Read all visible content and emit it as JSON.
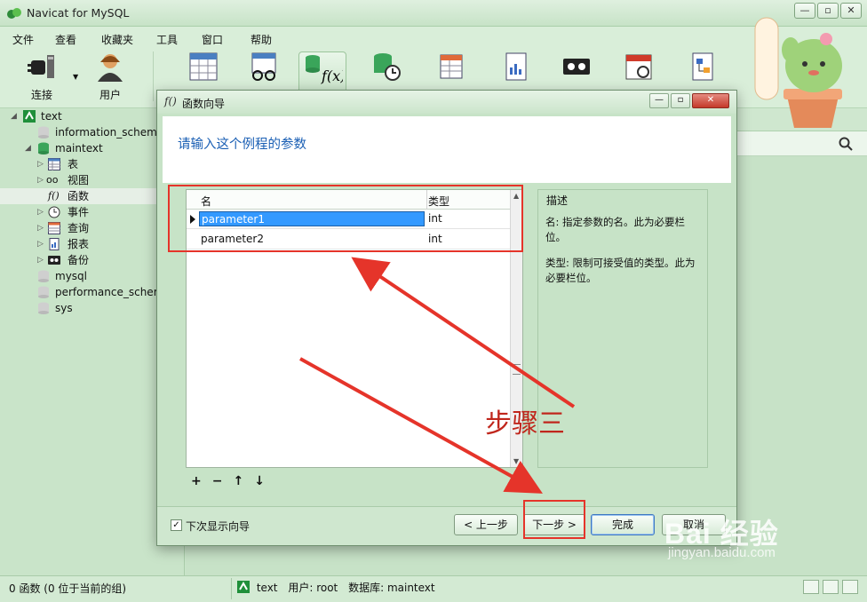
{
  "app": {
    "title": "Navicat for MySQL",
    "window_buttons": [
      "—",
      "▫",
      "✕"
    ]
  },
  "menu": [
    "文件",
    "查看",
    "收藏夹",
    "工具",
    "窗口",
    "帮助"
  ],
  "toolbar": {
    "connect_label": "连接",
    "user_label": "用户"
  },
  "sidebar": {
    "items": [
      {
        "label": "text",
        "icon": "connection-icon"
      },
      {
        "label": "information_schema",
        "icon": "database-icon"
      },
      {
        "label": "maintext",
        "icon": "database-icon"
      },
      {
        "label": "表",
        "icon": "table-icon"
      },
      {
        "label": "视图",
        "icon": "view-icon"
      },
      {
        "label": "函数",
        "icon": "function-icon"
      },
      {
        "label": "事件",
        "icon": "event-icon"
      },
      {
        "label": "查询",
        "icon": "query-icon"
      },
      {
        "label": "报表",
        "icon": "report-icon"
      },
      {
        "label": "备份",
        "icon": "backup-icon"
      },
      {
        "label": "mysql",
        "icon": "database-icon"
      },
      {
        "label": "performance_schema",
        "icon": "database-icon"
      },
      {
        "label": "sys",
        "icon": "database-icon"
      }
    ]
  },
  "dialog": {
    "icon_text": "f()",
    "title": "函数向导",
    "heading": "请输入这个例程的参数",
    "columns": {
      "name": "名",
      "type": "类型"
    },
    "rows": [
      {
        "name": "parameter1",
        "type": "int"
      },
      {
        "name": "parameter2",
        "type": "int"
      }
    ],
    "grid_tools": [
      "+",
      "−",
      "↑",
      "↓"
    ],
    "desc_title": "描述",
    "desc_name": "名: 指定参数的名。此为必要栏位。",
    "desc_type": "类型: 限制可接受值的类型。此为必要栏位。",
    "show_next_label": "下次显示向导",
    "show_next_checked": "✓",
    "buttons": {
      "prev": "< 上一步",
      "next": "下一步 >",
      "finish": "完成",
      "cancel": "取消"
    }
  },
  "annotation": {
    "text": "步骤三",
    "color": "#e5342a"
  },
  "status": {
    "left": "0 函数 (0 位于当前的组)",
    "connection": "text",
    "user": "用户: root",
    "database": "数据库: maintext"
  },
  "watermark": {
    "brand": "Bai 经验",
    "url": "jingyan.baidu.com"
  }
}
